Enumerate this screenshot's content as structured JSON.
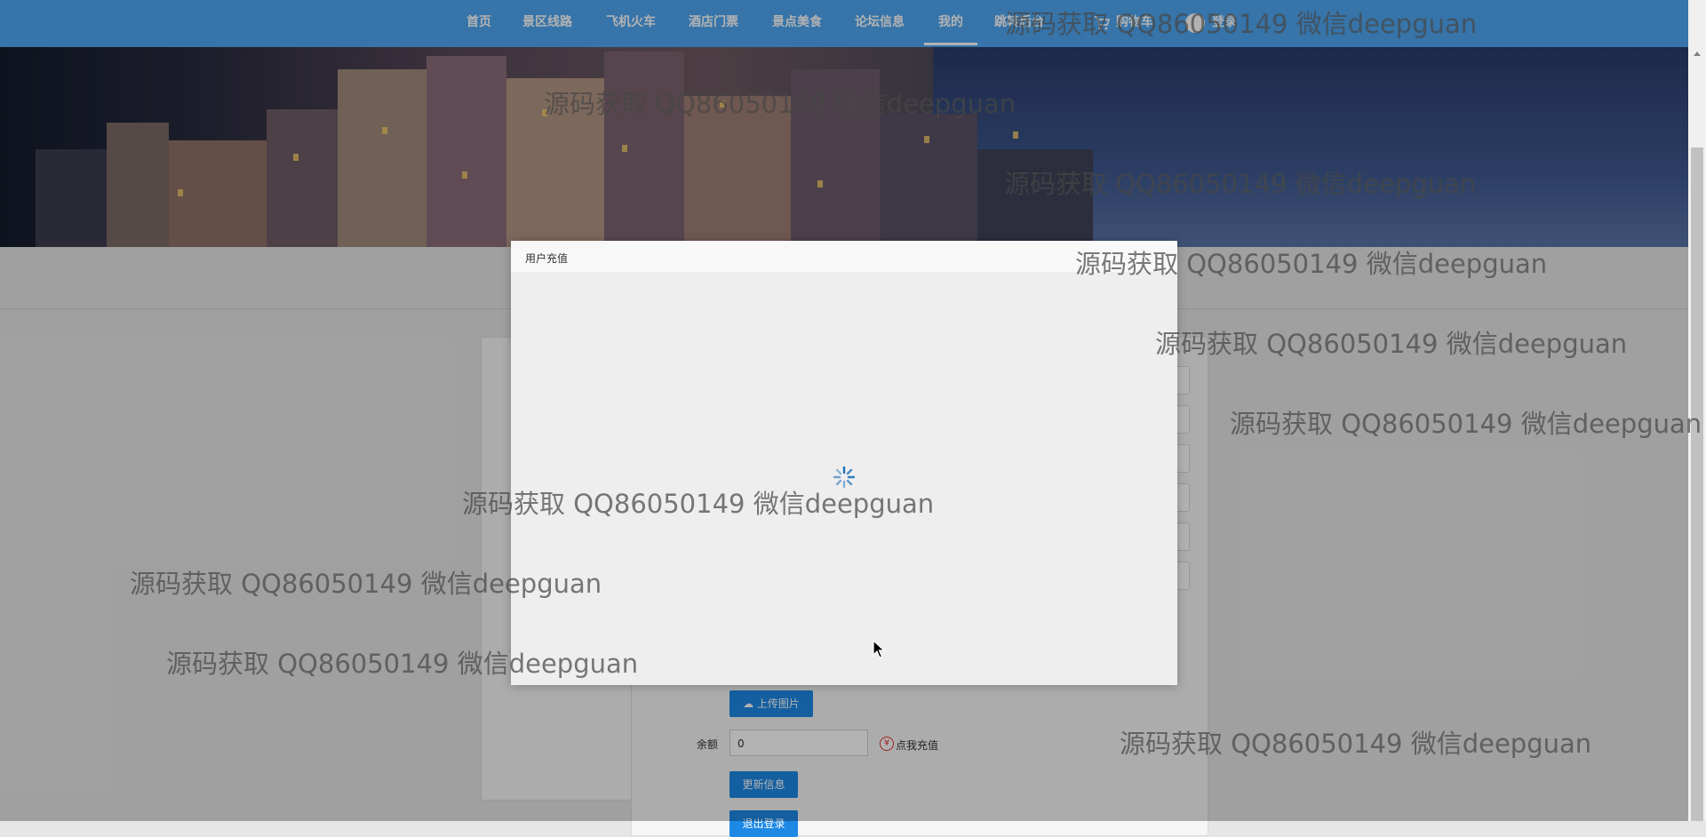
{
  "nav": {
    "items": [
      {
        "label": "首页"
      },
      {
        "label": "景区线路"
      },
      {
        "label": "飞机火车"
      },
      {
        "label": "酒店门票"
      },
      {
        "label": "景点美食"
      },
      {
        "label": "论坛信息"
      },
      {
        "label": "我的",
        "active": true
      },
      {
        "label": "跳转后台"
      }
    ],
    "cart_label": "购物车",
    "user_label": "登录",
    "colors": {
      "bar": "#4ea7f3",
      "text": "#ffffff"
    }
  },
  "profile": {
    "upload_label": "上传图片",
    "balance_label": "余额",
    "balance_value": "0",
    "recharge_label": "点我充值",
    "update_label": "更新信息",
    "logout_label": "退出登录"
  },
  "dialog": {
    "title": "用户充值",
    "loading_icon": "spinner-icon"
  },
  "watermark": {
    "text": "源码获取 QQ86050149 微信deepguan"
  }
}
